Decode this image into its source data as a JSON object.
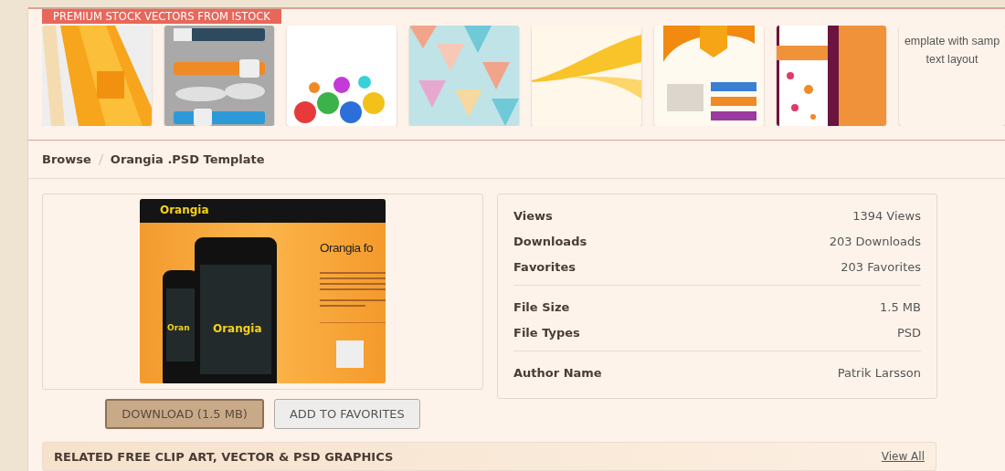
{
  "promo": {
    "label": "PREMIUM STOCK VECTORS FROM ISTOCK",
    "thumbnails": [
      {
        "kind": "picture"
      },
      {
        "kind": "picture"
      },
      {
        "kind": "picture"
      },
      {
        "kind": "picture"
      },
      {
        "kind": "picture"
      },
      {
        "kind": "picture"
      },
      {
        "kind": "picture"
      },
      {
        "kind": "text",
        "lines": [
          "emplate with samp",
          "text layout"
        ]
      }
    ]
  },
  "breadcrumb": [
    {
      "label": "Browse"
    },
    {
      "label": "Orangia .PSD Template"
    }
  ],
  "preview": {
    "brand": "Orangia",
    "heading": "Orangia fo",
    "phone_label": "Orangia",
    "small_phone_label": "Oran"
  },
  "buttons": [
    {
      "label": "DOWNLOAD (1.5 MB)",
      "kind": "primary"
    },
    {
      "label": "ADD TO FAVORITES",
      "kind": "secondary"
    }
  ],
  "details": [
    [
      {
        "label": "Views",
        "value": "1394 Views"
      },
      {
        "label": "Downloads",
        "value": "203 Downloads"
      },
      {
        "label": "Favorites",
        "value": "203 Favorites"
      }
    ],
    [
      {
        "label": "File Size",
        "value": "1.5 MB"
      },
      {
        "label": "File Types",
        "value": "PSD"
      }
    ],
    [
      {
        "label": "Author Name",
        "value": "Patrik Larsson"
      }
    ]
  ],
  "related": {
    "title": "RELATED FREE CLIP ART, VECTOR & PSD GRAPHICS",
    "link": "View All"
  }
}
